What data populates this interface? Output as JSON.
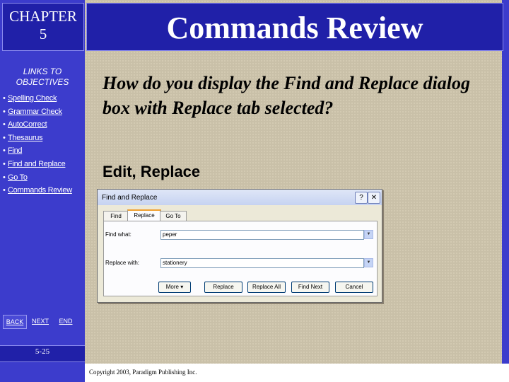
{
  "chapter": {
    "line1": "CHAPTER",
    "line2": "5"
  },
  "sidebar": {
    "links_title_line1": "LINKS TO",
    "links_title_line2": "OBJECTIVES",
    "items": [
      {
        "label": "Spelling Check"
      },
      {
        "label": "Grammar Check"
      },
      {
        "label": "AutoCorrect"
      },
      {
        "label": "Thesaurus"
      },
      {
        "label": "Find"
      },
      {
        "label": "Find and Replace"
      },
      {
        "label": "Go To"
      },
      {
        "label": "Commands Review"
      }
    ],
    "bullet": "•",
    "nav": {
      "back": "BACK",
      "next": "NEXT",
      "end": "END"
    },
    "page_number": "5-25"
  },
  "slide": {
    "title": "Commands Review",
    "question": "How do you display the Find and Replace dialog box with Replace tab selected?",
    "answer": "Edit, Replace",
    "copyright": "Copyright 2003, Paradigm Publishing Inc."
  },
  "dialog": {
    "title": "Find and Replace",
    "help": "?",
    "close": "✕",
    "tabs": [
      "Find",
      "Replace",
      "Go To"
    ],
    "selected_tab": "Replace",
    "find_label": "Find what:",
    "find_value": "peper",
    "replace_label": "Replace with:",
    "replace_value": "stationery",
    "buttons": [
      "More ▾",
      "Replace",
      "Replace All",
      "Find Next",
      "Cancel"
    ]
  },
  "colors": {
    "sidebar": "#3c3ccc",
    "header": "#2020a8",
    "background": "#c9c0a8"
  }
}
